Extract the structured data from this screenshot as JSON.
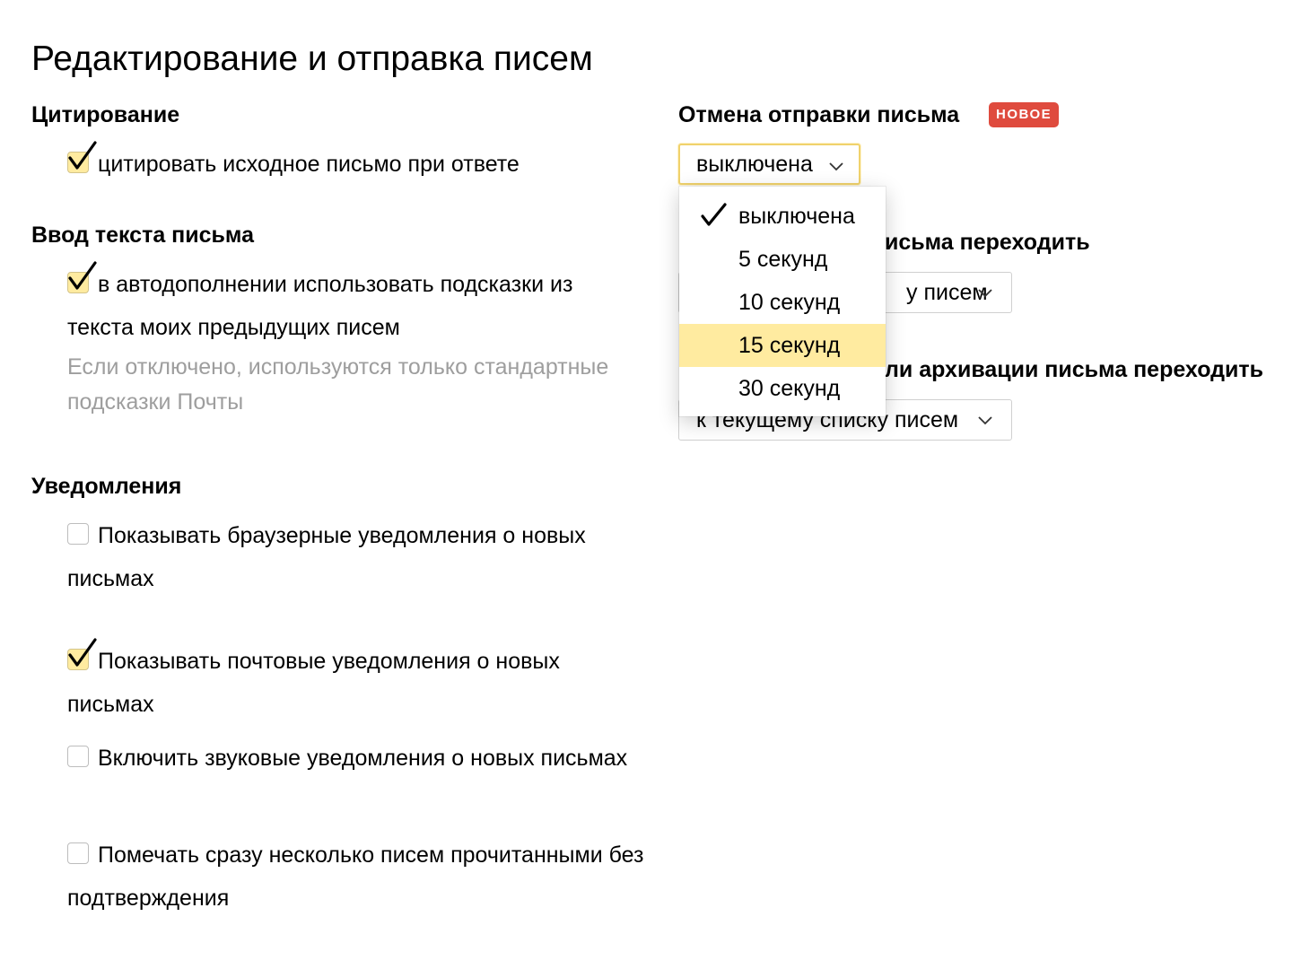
{
  "page_title": "Редактирование и отправка писем",
  "quoting": {
    "heading": "Цитирование",
    "options": [
      {
        "label": "цитировать исходное письмо при ответе",
        "checked": true
      }
    ]
  },
  "compose": {
    "heading": "Ввод текста письма",
    "options": [
      {
        "label": "в автодополнении использовать подсказки из текста моих предыдущих писем",
        "checked": true
      }
    ],
    "hint": "Если отключено, используются только стандартные подсказки Почты"
  },
  "notifications": {
    "heading": "Уведомления",
    "options": [
      {
        "label": "Показывать браузерные уведомления о новых письмах",
        "checked": false
      },
      {
        "label": "Показывать почтовые уведомления о новых письмах",
        "checked": true
      },
      {
        "label": "Включить звуковые уведомления о новых письмах",
        "checked": false
      },
      {
        "label": "Помечать сразу несколько писем прочитанными без подтверждения",
        "checked": false
      }
    ]
  },
  "undo_send": {
    "heading": "Отмена отправки письма",
    "badge": "НОВОЕ",
    "selected": "выключена",
    "menu": [
      {
        "label": "выключена",
        "checked": true,
        "highlighted": false
      },
      {
        "label": "5 секунд",
        "checked": false,
        "highlighted": false
      },
      {
        "label": "10 секунд",
        "checked": false,
        "highlighted": false
      },
      {
        "label": "15 секунд",
        "checked": false,
        "highlighted": true
      },
      {
        "label": "30 секунд",
        "checked": false,
        "highlighted": false
      }
    ]
  },
  "after_send": {
    "heading_visible": "исьма переходить",
    "value_visible": "у писем"
  },
  "after_delete": {
    "heading_visible": "ли архивации письма переходить",
    "value": "к текущему списку писем"
  },
  "colors": {
    "checkbox_checked_fill": "#ffeba0",
    "menu_highlight": "#ffeba0",
    "badge_bg": "#df4b3e",
    "hint_text": "#9e9e9e",
    "focus_border": "#f0d26c"
  }
}
